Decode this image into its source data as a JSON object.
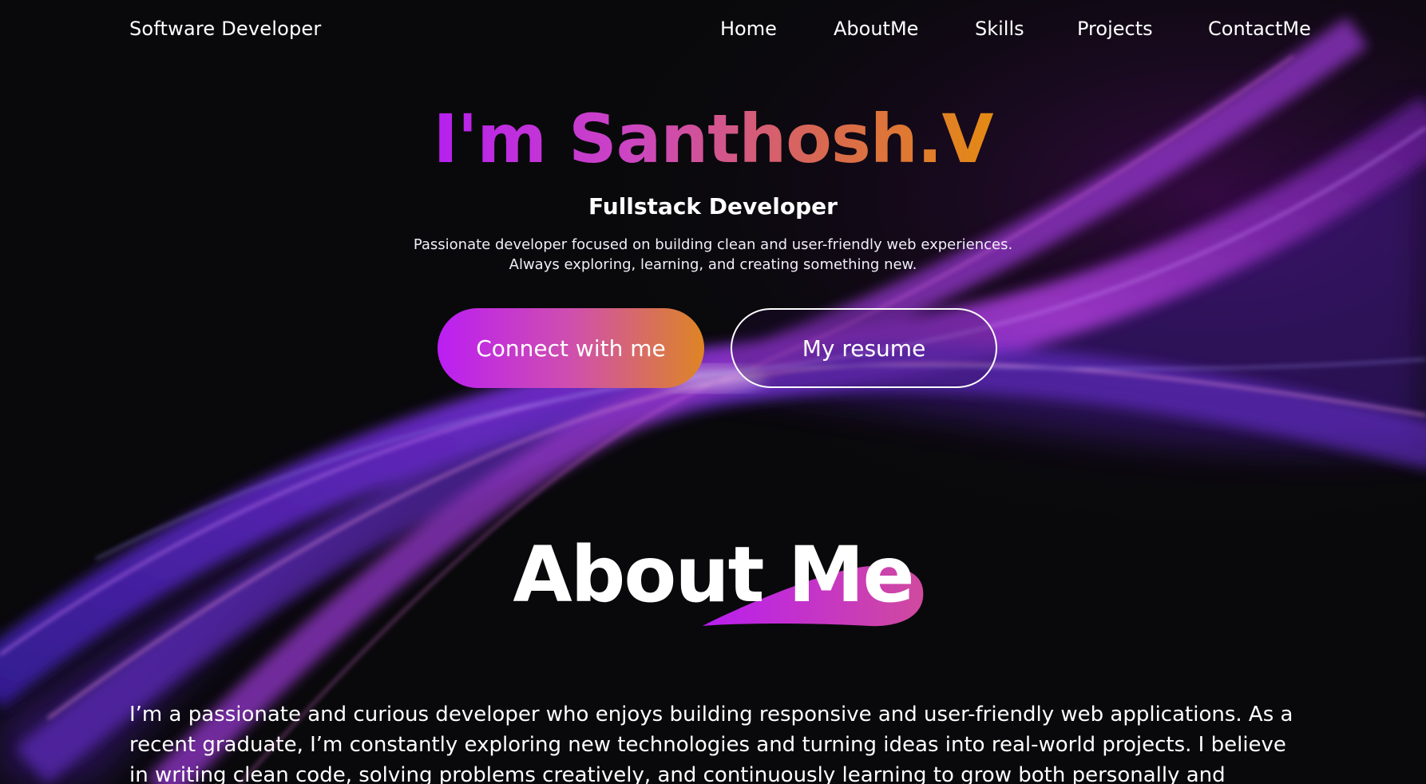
{
  "navbar": {
    "brand": "Software Developer",
    "links": [
      "Home",
      "AboutMe",
      "Skills",
      "Projects",
      "ContactMe"
    ]
  },
  "hero": {
    "title": "I'm Santhosh.V",
    "subtitle": "Fullstack Developer",
    "description_line1": "Passionate developer focused on building clean and user-friendly web experiences.",
    "description_line2": "Always exploring, learning, and creating something new.",
    "primary_button": "Connect with me",
    "secondary_button": "My resume"
  },
  "about": {
    "title": "About Me",
    "paragraph": "I’m a passionate and curious developer who enjoys building responsive and user-friendly web applications. As a recent graduate, I’m constantly exploring new technologies and turning ideas into real-world projects. I believe in writing clean code, solving problems creatively, and continuously learning to grow both personally and"
  },
  "colors": {
    "background": "#09090b",
    "gradient_start": "#b61ff0",
    "gradient_end": "#e48a14",
    "wave_purple": "#8a2be2"
  }
}
